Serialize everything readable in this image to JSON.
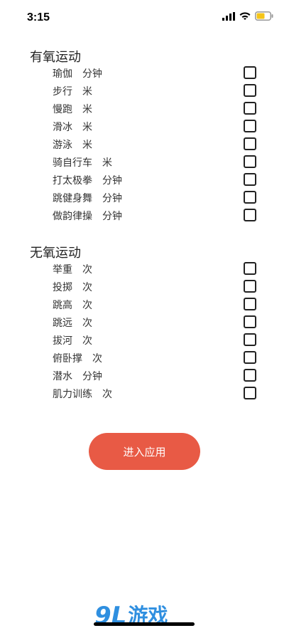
{
  "status": {
    "time": "3:15",
    "icons": [
      "signal-icon",
      "wifi-icon",
      "battery-icon"
    ]
  },
  "aerobic": {
    "title": "有氧运动",
    "items": [
      {
        "label": "瑜伽　分钟"
      },
      {
        "label": "步行　米"
      },
      {
        "label": "慢跑　米"
      },
      {
        "label": "滑冰　米"
      },
      {
        "label": "游泳　米"
      },
      {
        "label": "骑自行车　米"
      },
      {
        "label": "打太极拳　分钟"
      },
      {
        "label": "跳健身舞　分钟"
      },
      {
        "label": "做韵律操　分钟"
      }
    ]
  },
  "anaerobic": {
    "title": "无氧运动",
    "items": [
      {
        "label": "举重　次"
      },
      {
        "label": "投掷　次"
      },
      {
        "label": "跳高　次"
      },
      {
        "label": "跳远　次"
      },
      {
        "label": "拔河　次"
      },
      {
        "label": "俯卧撑　次"
      },
      {
        "label": "潜水　分钟"
      },
      {
        "label": "肌力训练　次"
      }
    ]
  },
  "enter_button": {
    "label": "进入应用",
    "color": "#e85a45"
  },
  "watermark": {
    "logo": "9L",
    "text": "游戏"
  }
}
